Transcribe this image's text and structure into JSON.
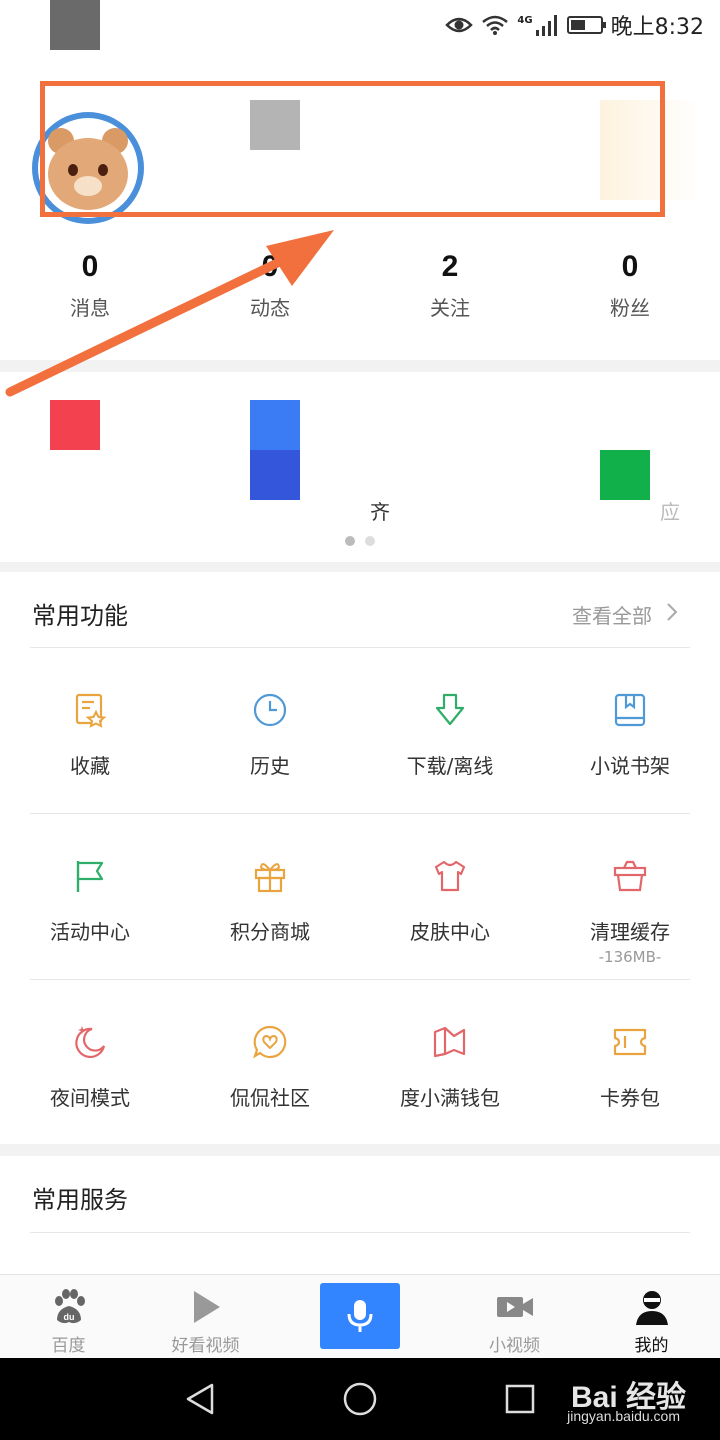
{
  "status_bar": {
    "time": "晚上8:32",
    "network": "4G",
    "icons": [
      "eye-icon",
      "wifi-icon",
      "signal-icon",
      "battery-icon"
    ]
  },
  "profile": {
    "stats": [
      {
        "value": "0",
        "label": "消息"
      },
      {
        "value": "0",
        "label": "动态"
      },
      {
        "value": "2",
        "label": "关注"
      },
      {
        "value": "0",
        "label": "粉丝"
      }
    ]
  },
  "banner": {
    "partial_text_1": "齐",
    "partial_text_2": "应",
    "page_dots": 2,
    "active_dot": 0
  },
  "common_functions": {
    "title": "常用功能",
    "see_all": "查看全部",
    "items": [
      {
        "label": "收藏",
        "icon": "favorites-icon",
        "color": "#e9a440"
      },
      {
        "label": "历史",
        "icon": "history-clock-icon",
        "color": "#4f9ad6"
      },
      {
        "label": "下载/离线",
        "icon": "download-icon",
        "color": "#2fae69"
      },
      {
        "label": "小说书架",
        "icon": "bookshelf-icon",
        "color": "#4f9ad6"
      },
      {
        "label": "活动中心",
        "icon": "flag-icon",
        "color": "#2fae69"
      },
      {
        "label": "积分商城",
        "icon": "gift-icon",
        "color": "#e9a440"
      },
      {
        "label": "皮肤中心",
        "icon": "tshirt-icon",
        "color": "#e2676a"
      },
      {
        "label": "清理缓存",
        "icon": "clean-basket-icon",
        "color": "#e2676a",
        "sub": "-136MB-"
      },
      {
        "label": "夜间模式",
        "icon": "moon-icon",
        "color": "#e2676a"
      },
      {
        "label": "侃侃社区",
        "icon": "chat-heart-icon",
        "color": "#e9a440"
      },
      {
        "label": "度小满钱包",
        "icon": "wallet-icon",
        "color": "#e2676a"
      },
      {
        "label": "卡券包",
        "icon": "coupon-icon",
        "color": "#e9a440"
      }
    ]
  },
  "common_services": {
    "title": "常用服务"
  },
  "tabbar": {
    "tabs": [
      {
        "label": "百度",
        "icon": "baidu-paw-icon"
      },
      {
        "label": "好看视频",
        "icon": "play-icon"
      },
      {
        "label": "",
        "icon": "microphone-icon"
      },
      {
        "label": "小视频",
        "icon": "video-camera-icon"
      },
      {
        "label": "我的",
        "icon": "user-icon"
      }
    ],
    "active": "我的",
    "accent": "#3385ff"
  },
  "nav": {
    "watermark": "Bai 经验",
    "watermark_url": "jingyan.baidu.com"
  },
  "colors": {
    "highlight": "#f2703d"
  }
}
